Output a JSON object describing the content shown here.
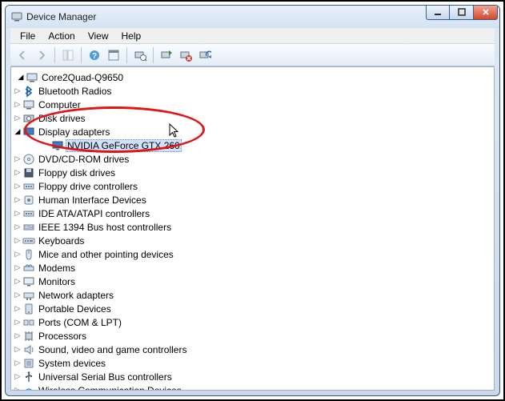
{
  "window": {
    "title": "Device Manager"
  },
  "menu": {
    "file": "File",
    "action": "Action",
    "view": "View",
    "help": "Help"
  },
  "tree": {
    "root": "Core2Quad-Q9650",
    "items": [
      {
        "label": "Bluetooth Radios"
      },
      {
        "label": "Computer"
      },
      {
        "label": "Disk drives"
      },
      {
        "label": "Display adapters",
        "expanded": true,
        "children": [
          {
            "label": "NVIDIA GeForce GTX 260",
            "selected": true
          }
        ]
      },
      {
        "label": "DVD/CD-ROM drives"
      },
      {
        "label": "Floppy disk drives"
      },
      {
        "label": "Floppy drive controllers"
      },
      {
        "label": "Human Interface Devices"
      },
      {
        "label": "IDE ATA/ATAPI controllers"
      },
      {
        "label": "IEEE 1394 Bus host controllers"
      },
      {
        "label": "Keyboards"
      },
      {
        "label": "Mice and other pointing devices"
      },
      {
        "label": "Modems"
      },
      {
        "label": "Monitors"
      },
      {
        "label": "Network adapters"
      },
      {
        "label": "Portable Devices"
      },
      {
        "label": "Ports (COM & LPT)"
      },
      {
        "label": "Processors"
      },
      {
        "label": "Sound, video and game controllers"
      },
      {
        "label": "System devices"
      },
      {
        "label": "Universal Serial Bus controllers"
      },
      {
        "label": "Wireless Communication Devices"
      }
    ]
  }
}
